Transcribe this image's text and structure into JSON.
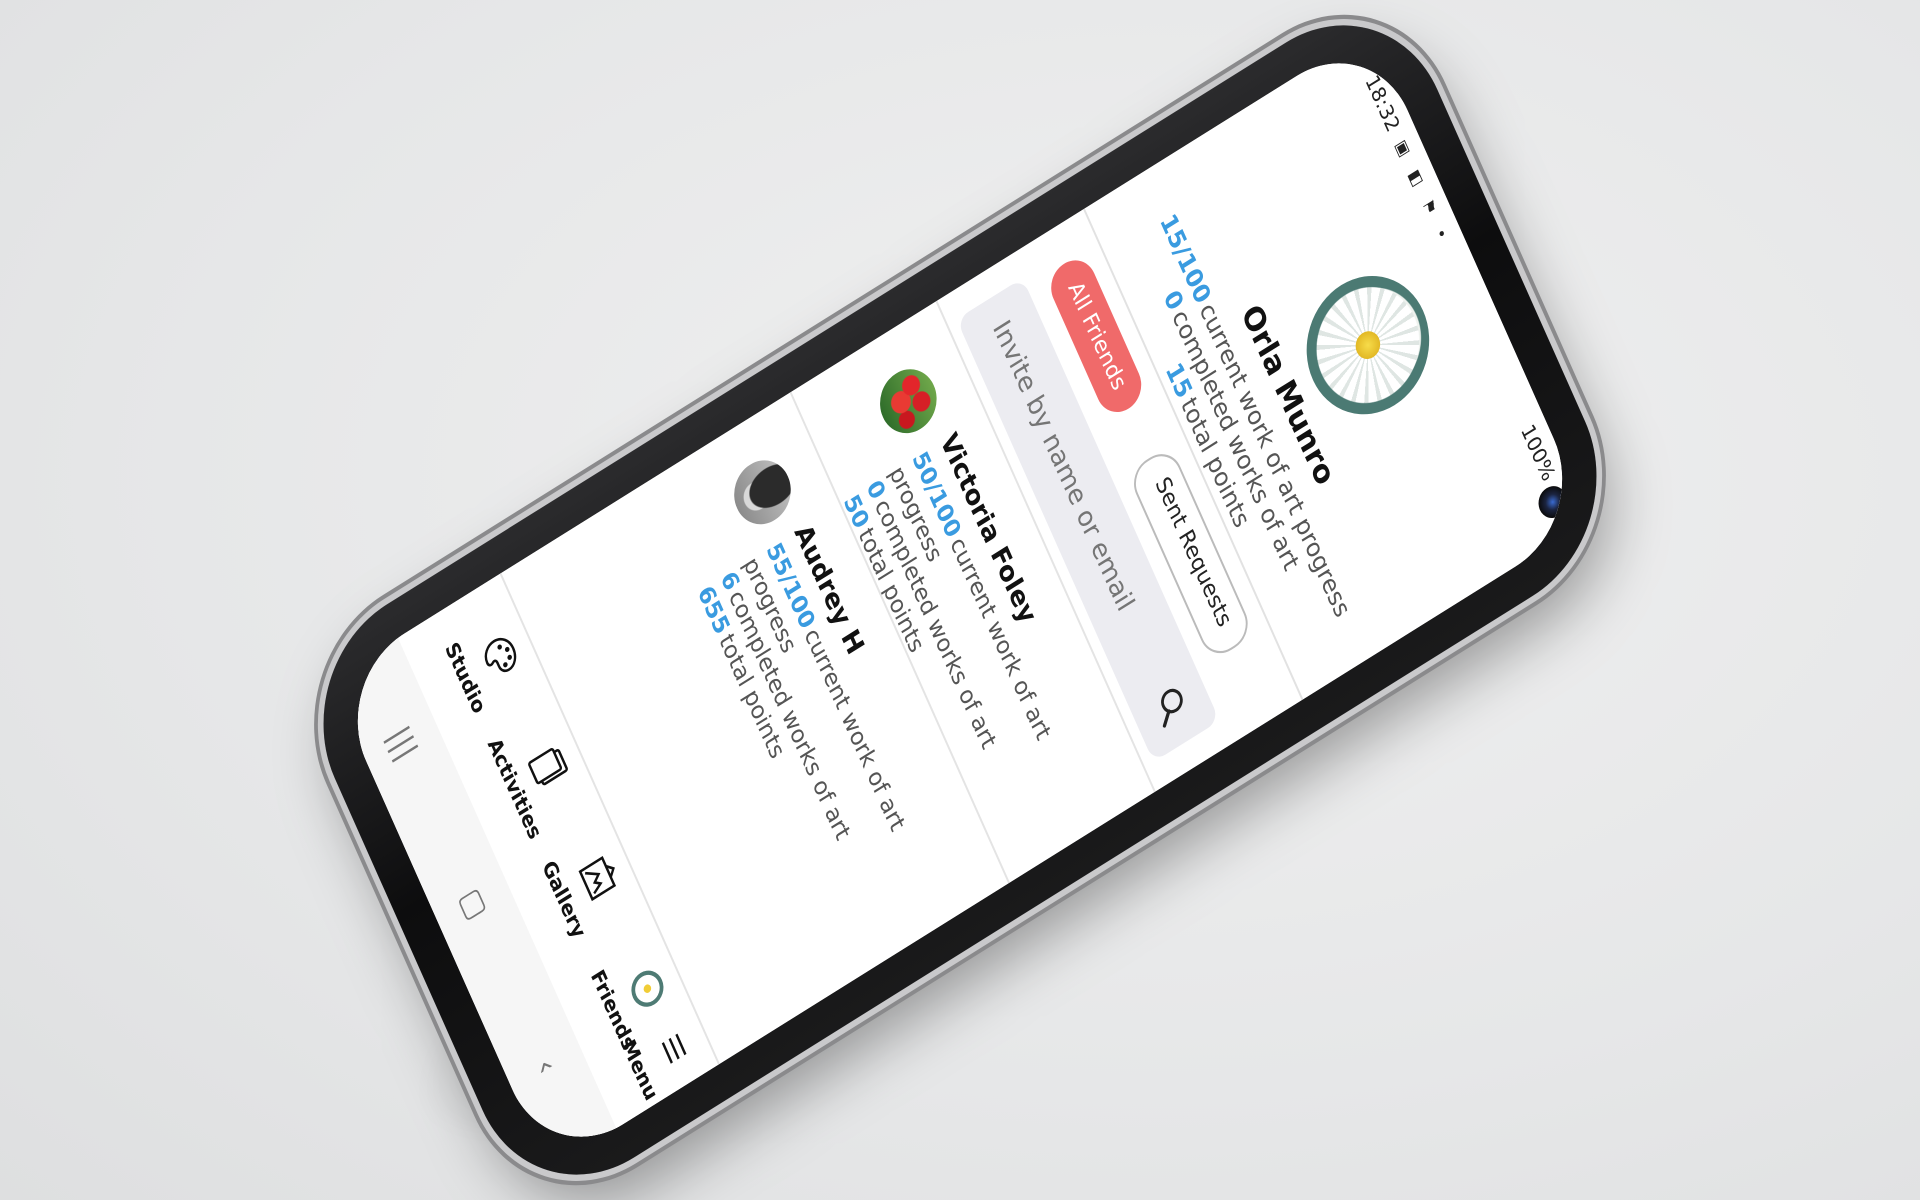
{
  "status_bar": {
    "time": "18:32",
    "battery": "100%"
  },
  "profile": {
    "name": "Orla Munro",
    "current_progress": "15/100",
    "current_progress_label": "current work of art progress",
    "completed": "0",
    "completed_label": "completed works of art",
    "points": "15",
    "points_label": "total points",
    "avatar_icon": "daisy-flower"
  },
  "tabs": [
    {
      "label": "All Friends",
      "active": true
    },
    {
      "label": "Sent Requests",
      "active": false
    }
  ],
  "search": {
    "placeholder": "Invite by name or email"
  },
  "friends": [
    {
      "name": "Victoria Foley",
      "current_progress": "50/100",
      "current_progress_label": "current work of art progress",
      "completed": "0",
      "completed_label": "completed works of art",
      "points": "50",
      "points_label": "total points",
      "avatar_icon": "red-tulips"
    },
    {
      "name": "Audrey H",
      "current_progress": "55/100",
      "current_progress_label": "current work of art progress",
      "completed": "6",
      "completed_label": "completed works of art",
      "points": "655",
      "points_label": "total points",
      "avatar_icon": "woman-in-hat"
    }
  ],
  "nav": {
    "studio": "Studio",
    "activities": "Activities",
    "gallery": "Gallery",
    "friends": "Friends",
    "menu": "Menu"
  },
  "colors": {
    "accent_blue": "#3a9be0",
    "active_tab": "#f06a6a"
  }
}
